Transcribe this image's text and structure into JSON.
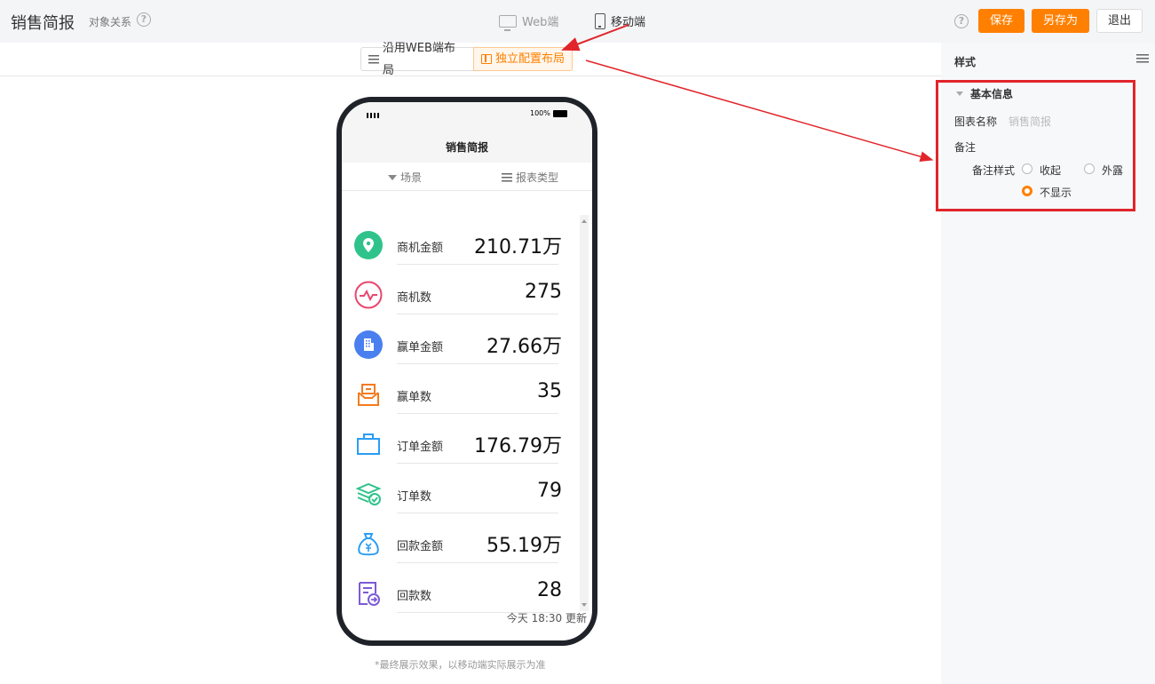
{
  "header": {
    "title": "销售简报",
    "relation_link": "对象关系",
    "device_tabs": {
      "web": "Web端",
      "mobile": "移动端"
    },
    "save_label": "保存",
    "save_as_label": "另存为",
    "exit_label": "退出"
  },
  "layout_toggle": {
    "use_web": "沿用WEB端布局",
    "independent": "独立配置布局"
  },
  "panel": {
    "title": "样式",
    "section": "基本信息",
    "chart_name_label": "图表名称",
    "chart_name_value": "销售简报",
    "note_label": "备注",
    "note_style_label": "备注样式",
    "option_collapse": "收起",
    "option_expose": "外露",
    "option_hide": "不显示"
  },
  "phone": {
    "battery": "100%",
    "title": "销售简报",
    "filter_scene": "场景",
    "filter_type": "报表类型",
    "metrics": [
      {
        "label": "商机金额",
        "value": "210.71万"
      },
      {
        "label": "商机数",
        "value": "275"
      },
      {
        "label": "赢单金额",
        "value": "27.66万"
      },
      {
        "label": "赢单数",
        "value": "35"
      },
      {
        "label": "订单金额",
        "value": "176.79万"
      },
      {
        "label": "订单数",
        "value": "79"
      },
      {
        "label": "回款金额",
        "value": "55.19万"
      },
      {
        "label": "回款数",
        "value": "28"
      }
    ],
    "update_text": "今天 18:30 更新"
  },
  "footnote": "*最终展示效果，以移动端实际展示为准",
  "colors": {
    "accent": "#ff8000",
    "highlight": "#e0252b"
  }
}
